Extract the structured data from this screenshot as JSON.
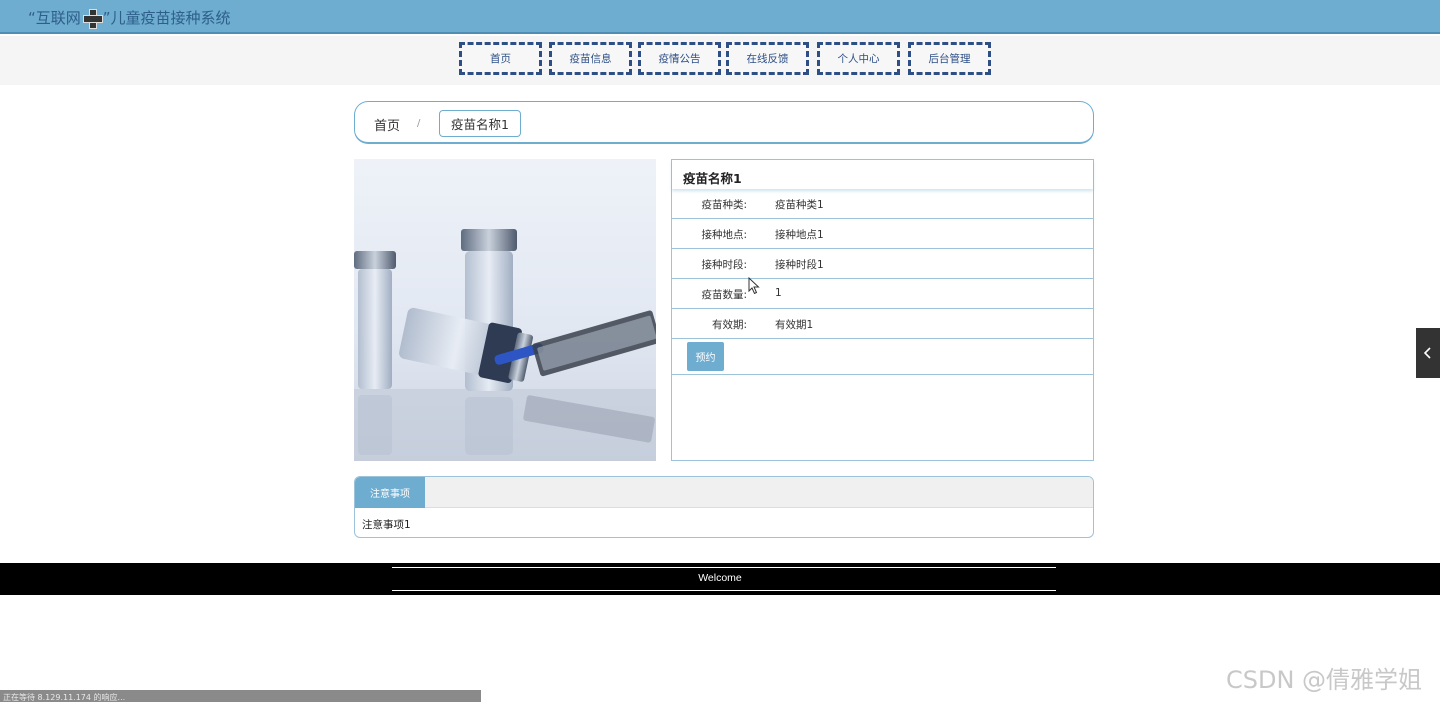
{
  "header": {
    "title_prefix": "“互联网",
    "title_suffix": "”儿童疫苗接种系统",
    "logo_icon": "plus-cross-icon"
  },
  "nav": {
    "items": [
      {
        "label": "首页"
      },
      {
        "label": "疫苗信息"
      },
      {
        "label": "疫情公告"
      },
      {
        "label": "在线反馈"
      },
      {
        "label": "个人中心"
      },
      {
        "label": "后台管理"
      }
    ]
  },
  "breadcrumb": {
    "home": "首页",
    "separator": "/",
    "current": "疫苗名称1"
  },
  "product": {
    "image_icon": "vaccine-vials-syringe-image",
    "name": "疫苗名称1",
    "fields": [
      {
        "label": "疫苗种类:",
        "value": "疫苗种类1"
      },
      {
        "label": "接种地点:",
        "value": "接种地点1"
      },
      {
        "label": "接种时段:",
        "value": "接种时段1"
      },
      {
        "label": "疫苗数量:",
        "value": "1"
      },
      {
        "label": "有效期:",
        "value": "有效期1"
      }
    ],
    "reserve_label": "预约"
  },
  "notes": {
    "tab_label": "注意事项",
    "content": "注意事项1"
  },
  "footer": {
    "text": "Welcome"
  },
  "status_bar": {
    "text": "正在等待 8.129.11.174 的响应..."
  },
  "watermark": {
    "text": "CSDN @倩雅学姐"
  },
  "colors": {
    "primary": "#6eacd0",
    "nav_border": "#2d4f86",
    "footer_bg": "#000000"
  }
}
